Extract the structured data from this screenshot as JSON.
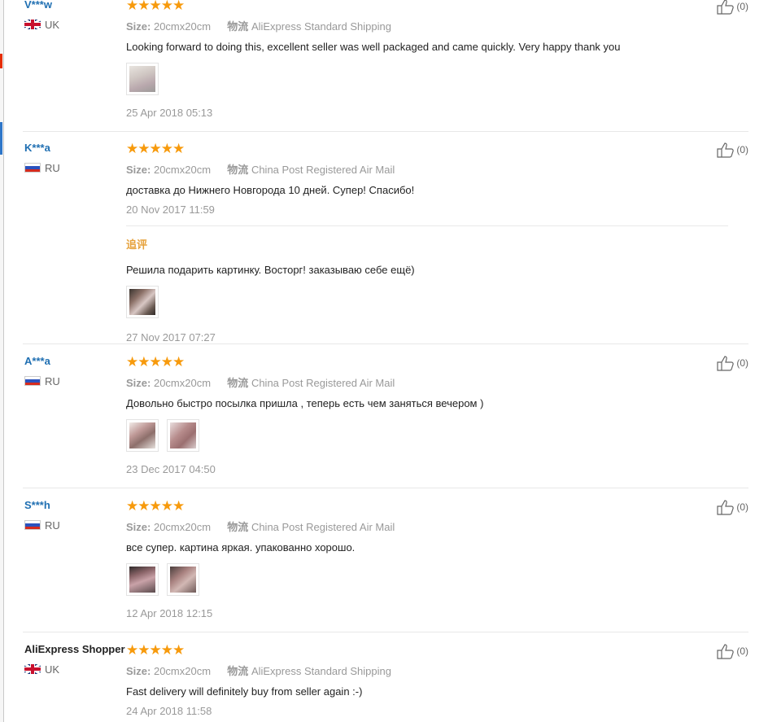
{
  "labels": {
    "size": "Size:",
    "shipping": "物流",
    "followup": "追评"
  },
  "reviews": [
    {
      "user": "V***w",
      "country": "UK",
      "flag": "uk",
      "stars": "★★★★★",
      "size": "20cmx20cm",
      "shipping": "AliExpress Standard Shipping",
      "text": "Looking forward to doing this, excellent seller was well packaged and came quickly. Very happy thank you",
      "date": "25 Apr 2018 05:13",
      "likes": "(0)"
    },
    {
      "user": "K***a",
      "country": "RU",
      "flag": "ru",
      "stars": "★★★★★",
      "size": "20cmx20cm",
      "shipping": "China Post Registered Air Mail",
      "text": "доставка до Нижнего Новгорода 10 дней. Супер! Спасибо!",
      "date": "20 Nov 2017 11:59",
      "likes": "(0)",
      "followup_text": "Решила подарить картинку. Восторг! заказываю себе ещё)",
      "followup_date": "27 Nov 2017 07:27"
    },
    {
      "user": "A***a",
      "country": "RU",
      "flag": "ru",
      "stars": "★★★★★",
      "size": "20cmx20cm",
      "shipping": "China Post Registered Air Mail",
      "text": "Довольно быстро посылка пришла , теперь есть чем заняться вечером )",
      "date": "23 Dec 2017 04:50",
      "likes": "(0)"
    },
    {
      "user": "S***h",
      "country": "RU",
      "flag": "ru",
      "stars": "★★★★★",
      "size": "20cmx20cm",
      "shipping": "China Post Registered Air Mail",
      "text": "все супер. картина яркая. упакованно хорошо.",
      "date": "12 Apr 2018 12:15",
      "likes": "(0)"
    },
    {
      "user": "AliExpress Shopper",
      "country": "UK",
      "flag": "uk",
      "stars": "★★★★★",
      "size": "20cmx20cm",
      "shipping": "AliExpress Standard Shipping",
      "text": "Fast delivery will definitely buy from seller again :-)",
      "date": "24 Apr 2018 11:58",
      "likes": "(0)"
    }
  ]
}
